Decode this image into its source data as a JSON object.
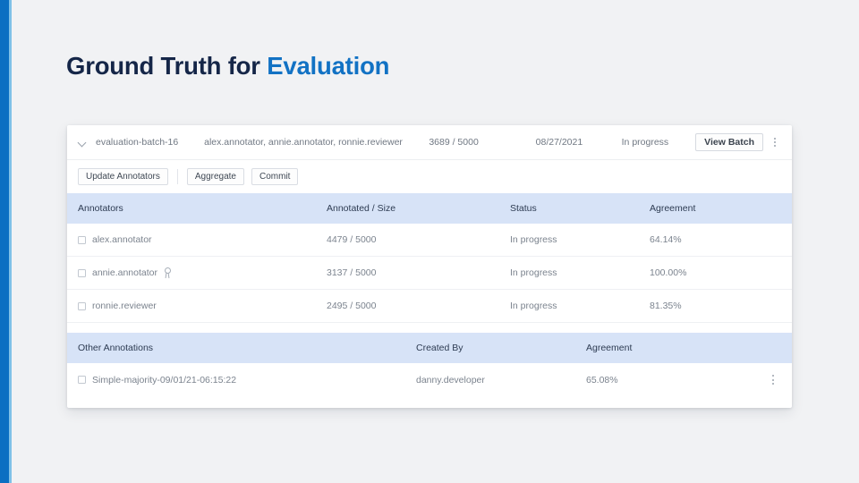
{
  "slide": {
    "title_main": "Ground Truth for ",
    "title_accent": "Evaluation",
    "accent_color": "#1272c4",
    "sidebar_color": "#0b6fc2",
    "background_color": "#f1f2f4"
  },
  "batch_header": {
    "expand_icon": "chevron-down-icon",
    "batch_name": "evaluation-batch-16",
    "annotators": "alex.annotator, annie.annotator, ronnie.reviewer",
    "progress": "3689 / 5000",
    "date": "08/27/2021",
    "status": "In progress",
    "view_batch_label": "View Batch",
    "overflow_icon": "kebab-menu-icon"
  },
  "toolbar": {
    "update_annotators_label": "Update Annotators",
    "aggregate_label": "Aggregate",
    "commit_label": "Commit"
  },
  "annotators_table": {
    "headers": [
      "Annotators",
      "Annotated / Size",
      "Status",
      "Agreement"
    ],
    "rows": [
      {
        "name": "alex.annotator",
        "badge": false,
        "annotated": "4479 / 5000",
        "status": "In progress",
        "agreement": "64.14%"
      },
      {
        "name": "annie.annotator",
        "badge": true,
        "badge_icon": "award-icon",
        "annotated": "3137 / 5000",
        "status": "In progress",
        "agreement": "100.00%"
      },
      {
        "name": "ronnie.reviewer",
        "badge": false,
        "annotated": "2495 / 5000",
        "status": "In progress",
        "agreement": "81.35%"
      }
    ]
  },
  "other_annotations_table": {
    "headers": [
      "Other Annotations",
      "Created By",
      "Agreement"
    ],
    "rows": [
      {
        "name": "Simple-majority-09/01/21-06:15:22",
        "created_by": "danny.developer",
        "agreement": "65.08%",
        "overflow_icon": "kebab-menu-icon"
      }
    ]
  }
}
